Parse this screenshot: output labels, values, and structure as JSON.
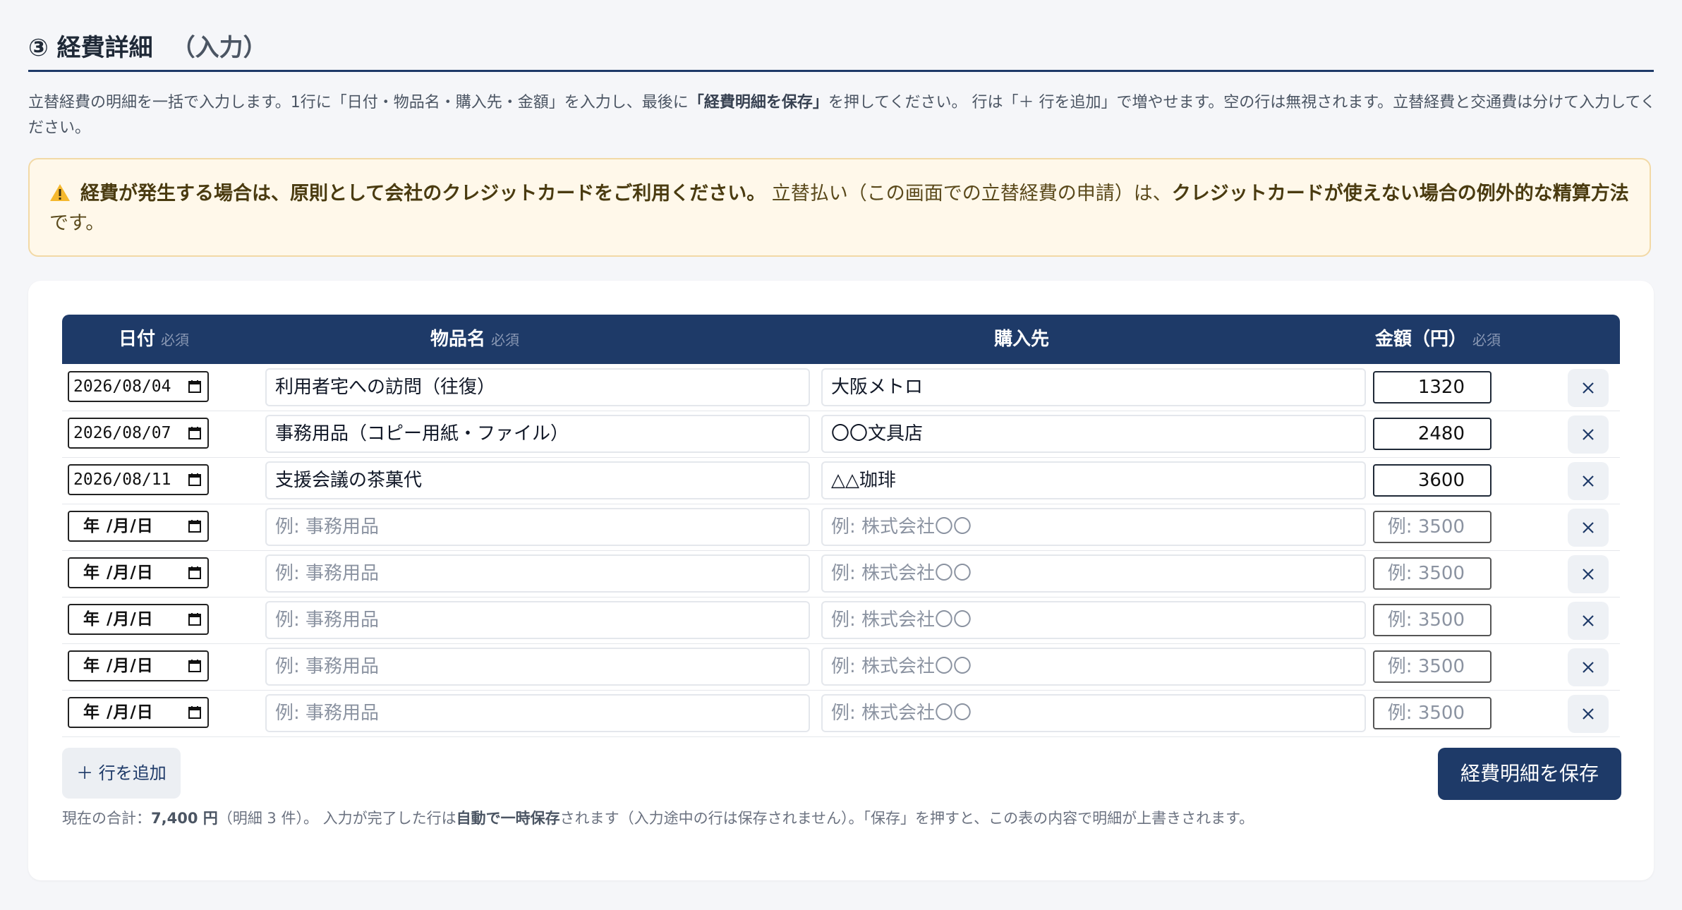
{
  "section": {
    "title": "③ 経費詳細",
    "subtitle": "（入力）"
  },
  "intro": {
    "part1": "立替経費の明細を一括で入力します。1行に「日付・物品名・購入先・金額」を入力し、最後に",
    "bold": "「経費明細を保存」",
    "part2": "を押してください。 行は「＋ 行を追加」で増やせます。空の行は無視されます。立替経費と交通費は分けて入力してください。"
  },
  "alert": {
    "icon": "warning-icon",
    "bold1": "経費が発生する場合は、原則として会社のクレジットカードをご利用ください。",
    "normal1": " 立替払い（この画面での立替経費の申請）は、",
    "bold2": "クレジットカードが使えない場合の例外的な精算方法",
    "normal2": "です。"
  },
  "table": {
    "headers": {
      "date": "日付",
      "item": "物品名",
      "vendor": "購入先",
      "amount": "金額（円）",
      "required": "必須"
    },
    "rows": [
      {
        "date": "2026/08/04",
        "item": "利用者宅への訪問（往復）",
        "vendor": "大阪メトロ",
        "amount": "1320"
      },
      {
        "date": "2026/08/07",
        "item": "事務用品（コピー用紙・ファイル）",
        "vendor": "〇〇文具店",
        "amount": "2480"
      },
      {
        "date": "2026/08/11",
        "item": "支援会議の茶菓代",
        "vendor": "△△珈琲",
        "amount": "3600"
      },
      {
        "date": "",
        "item": "",
        "vendor": "",
        "amount": ""
      },
      {
        "date": "",
        "item": "",
        "vendor": "",
        "amount": ""
      },
      {
        "date": "",
        "item": "",
        "vendor": "",
        "amount": ""
      },
      {
        "date": "",
        "item": "",
        "vendor": "",
        "amount": ""
      },
      {
        "date": "",
        "item": "",
        "vendor": "",
        "amount": ""
      }
    ],
    "placeholders": {
      "date": "年 /月/日",
      "item": "例: 事務用品",
      "vendor": "例: 株式会社〇〇",
      "amount": "例: 3500"
    }
  },
  "actions": {
    "add_row": "＋ 行を追加",
    "save": "経費明細を保存"
  },
  "footer": {
    "p1": "現在の合計：",
    "total": "7,400 円",
    "p2": "（明細 3 件）。 入力が完了した行は",
    "bold": "自動で一時保存",
    "p3": "されます（入力途中の行は保存されません）。「保存」を押すと、この表の内容で明細が上書きされます。"
  },
  "colors": {
    "accent": "#1e3a68",
    "alert_bg": "#fff8ea",
    "alert_border": "#f2d9a6"
  }
}
